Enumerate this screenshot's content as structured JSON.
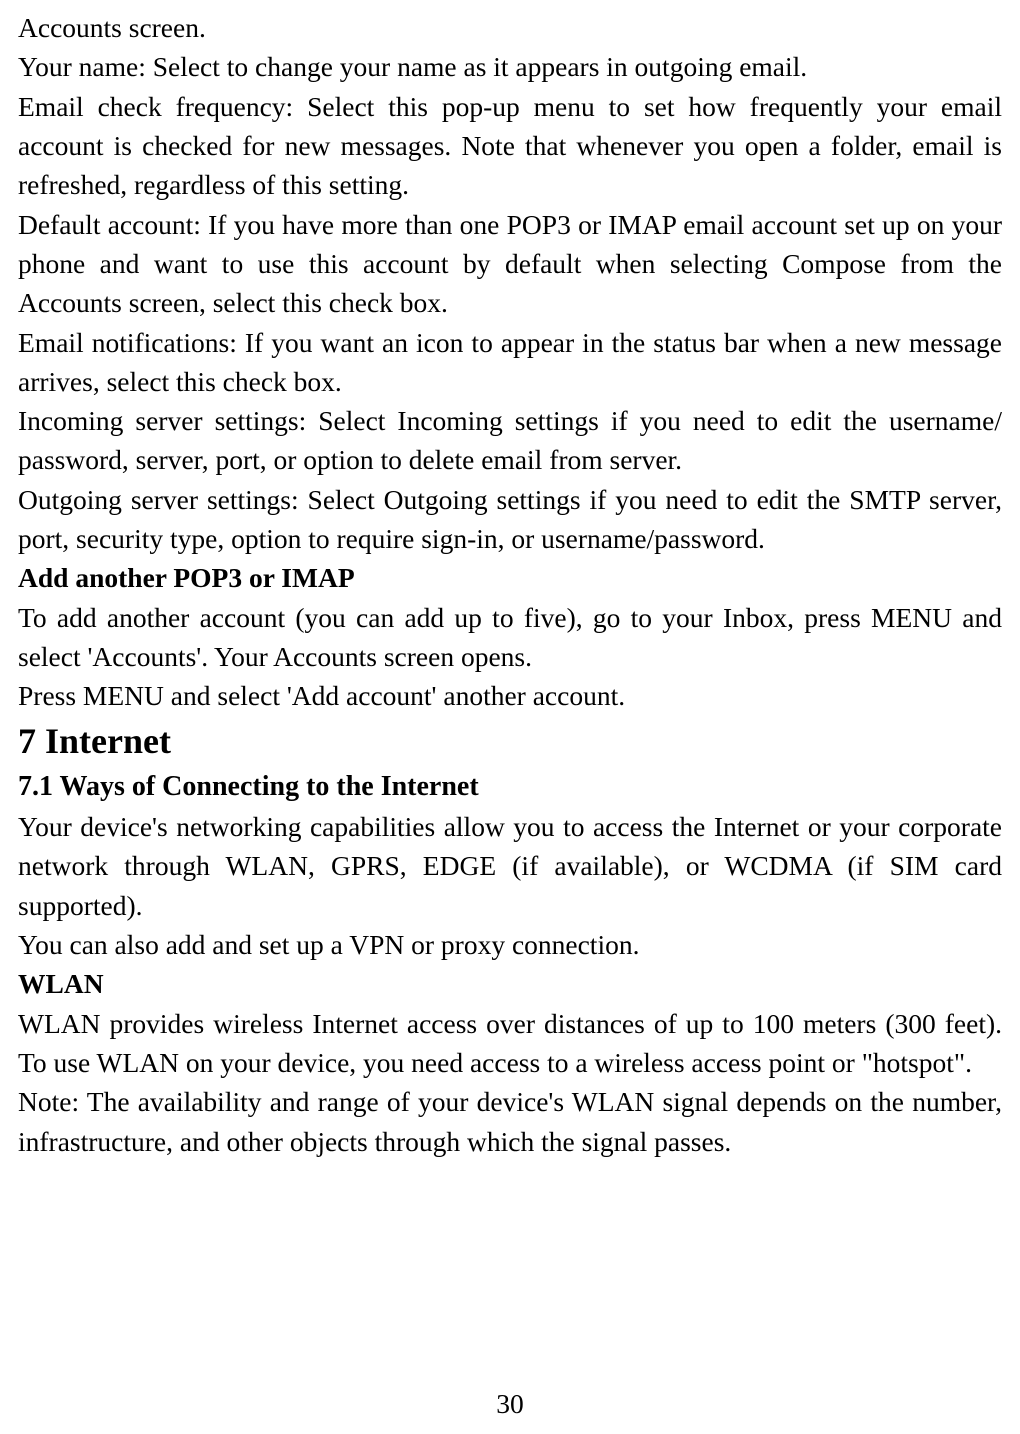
{
  "content": {
    "para1": "Accounts screen.",
    "para2": "Your name: Select to change your name as it appears in outgoing email.",
    "para3": "Email check frequency: Select this pop-up menu to set how frequently your email account is checked for new messages. Note that whenever you open a folder, email is refreshed, regardless of this setting.",
    "para4": "Default account: If you have more than one POP3 or IMAP email account set up on your phone and want to use this account by default when selecting Compose from the Accounts screen, select this check box.",
    "para5": "Email notifications: If you want an icon to appear in the status bar when a new message arrives, select this check box.",
    "para6": "Incoming server settings: Select Incoming settings if you need to edit the username/ password, server, port, or option to delete email from server.",
    "para7": "Outgoing server settings: Select Outgoing settings if you need to edit the SMTP server, port, security type, option to require sign-in, or username/password.",
    "heading_add": "Add another POP3 or IMAP",
    "para8": "To add another account (you can add up to five), go to your Inbox, press MENU and select 'Accounts'. Your Accounts screen opens.",
    "para9": "Press MENU and select 'Add account' another account.",
    "heading_chapter": "7 Internet",
    "heading_section": "7.1 Ways of Connecting to the Internet",
    "para10": "Your device's networking capabilities allow you to access the Internet or your corporate network through WLAN, GPRS, EDGE (if available), or WCDMA (if SIM card supported).",
    "para11": "You can also add and set up a VPN or proxy connection.",
    "heading_wlan": "WLAN",
    "para12": "WLAN provides wireless Internet access over distances of up to 100 meters (300 feet). To use WLAN on your device, you need access to a wireless access point or \"hotspot\".",
    "para13": "Note: The availability and range of your device's WLAN signal depends on the number, infrastructure, and other objects through which the signal passes."
  },
  "page_number": "30"
}
